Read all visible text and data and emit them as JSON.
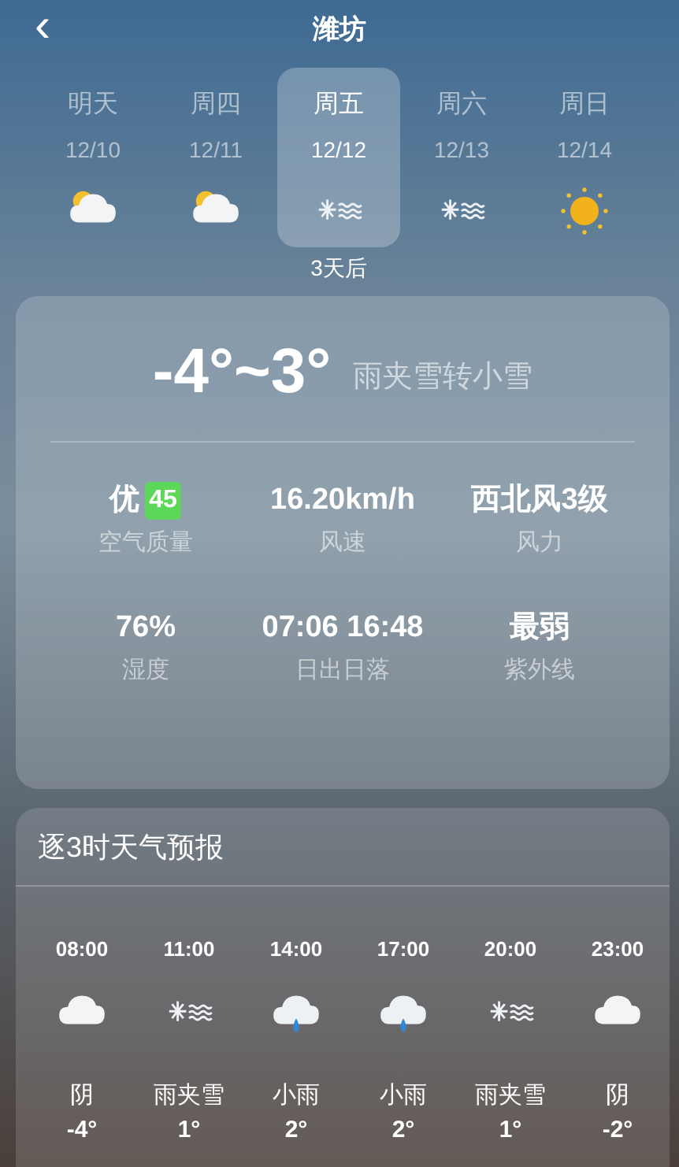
{
  "header": {
    "back_icon": "‹",
    "title": "潍坊"
  },
  "days": [
    {
      "name": "明天",
      "date": "12/10",
      "kind": "partly_cloudy",
      "selected": false
    },
    {
      "name": "周四",
      "date": "12/11",
      "kind": "partly_cloudy",
      "selected": false
    },
    {
      "name": "周五",
      "date": "12/12",
      "kind": "sleet",
      "selected": true,
      "note": "3天后"
    },
    {
      "name": "周六",
      "date": "12/13",
      "kind": "sleet",
      "selected": false
    },
    {
      "name": "周日",
      "date": "12/14",
      "kind": "sunny",
      "selected": false
    }
  ],
  "summary": {
    "temp_range": "-4°~3°",
    "condition": "雨夹雪转小雪",
    "stats": [
      {
        "value": "优",
        "badge": "45",
        "label": "空气质量"
      },
      {
        "value": "16.20km/h",
        "label": "风速"
      },
      {
        "value": "西北风3级",
        "label": "风力"
      },
      {
        "value": "76%",
        "label": "湿度"
      },
      {
        "value": "07:06 16:48",
        "label": "日出日落"
      },
      {
        "value": "最弱",
        "label": "紫外线"
      }
    ]
  },
  "hourly": {
    "title": "逐3时天气预报",
    "items": [
      {
        "time": "08:00",
        "kind": "cloudy",
        "condition": "阴",
        "temp": "-4°"
      },
      {
        "time": "11:00",
        "kind": "sleet",
        "condition": "雨夹雪",
        "temp": "1°"
      },
      {
        "time": "14:00",
        "kind": "rain",
        "condition": "小雨",
        "temp": "2°"
      },
      {
        "time": "17:00",
        "kind": "rain",
        "condition": "小雨",
        "temp": "2°"
      },
      {
        "time": "20:00",
        "kind": "sleet",
        "condition": "雨夹雪",
        "temp": "1°"
      },
      {
        "time": "23:00",
        "kind": "cloudy",
        "condition": "阴",
        "temp": "-2°"
      }
    ]
  }
}
